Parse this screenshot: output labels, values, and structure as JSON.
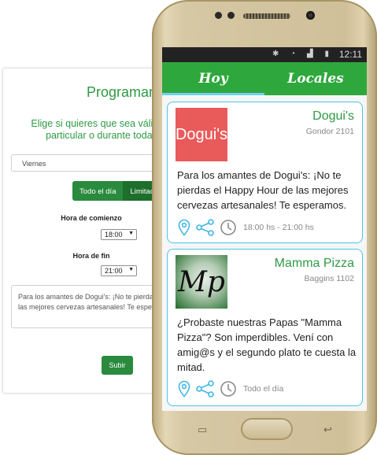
{
  "web_form": {
    "title": "Programar",
    "description_line1": "Elige si quieres que sea válido d",
    "description_line2": "particular o durante toda l",
    "day_select": "Viernes",
    "toggle": {
      "all_day": "Todo el día",
      "limited": "Limitado"
    },
    "start_label": "Hora de comienzo",
    "start_value": "18:00",
    "end_label": "Hora de fin",
    "end_value": "21:00",
    "message_line1": "Para los amantes de Dogui's: ¡No te pierdas",
    "message_line2": "las mejores cervezas artesanales! Te espera",
    "submit_label": "Subir"
  },
  "phone": {
    "status_time": "12:11",
    "tabs": {
      "hoy": "Hoy",
      "locales": "Locales"
    },
    "cards": [
      {
        "logo_text": "Dogui's",
        "name": "Dogui's",
        "address": "Gondor 2101",
        "text": "Para los amantes de Dogui's: ¡No te pierdas el Happy Hour de las mejores cervezas artesanales! Te esperamos.",
        "when": "18:00 hs - 21:00 hs"
      },
      {
        "logo_text": "Mp",
        "name": "Mamma Pizza",
        "address": "Baggins 1102",
        "text": "¿Probaste nuestras Papas \"Mamma Pizza\"? Son imperdibles. Vení con amig@s y el segundo plato te cuesta la mitad.",
        "when": "Todo el día"
      }
    ]
  },
  "colors": {
    "brand_green": "#2ea83d",
    "accent_cyan": "#48c7e8",
    "doguis_red": "#e95a5a"
  }
}
